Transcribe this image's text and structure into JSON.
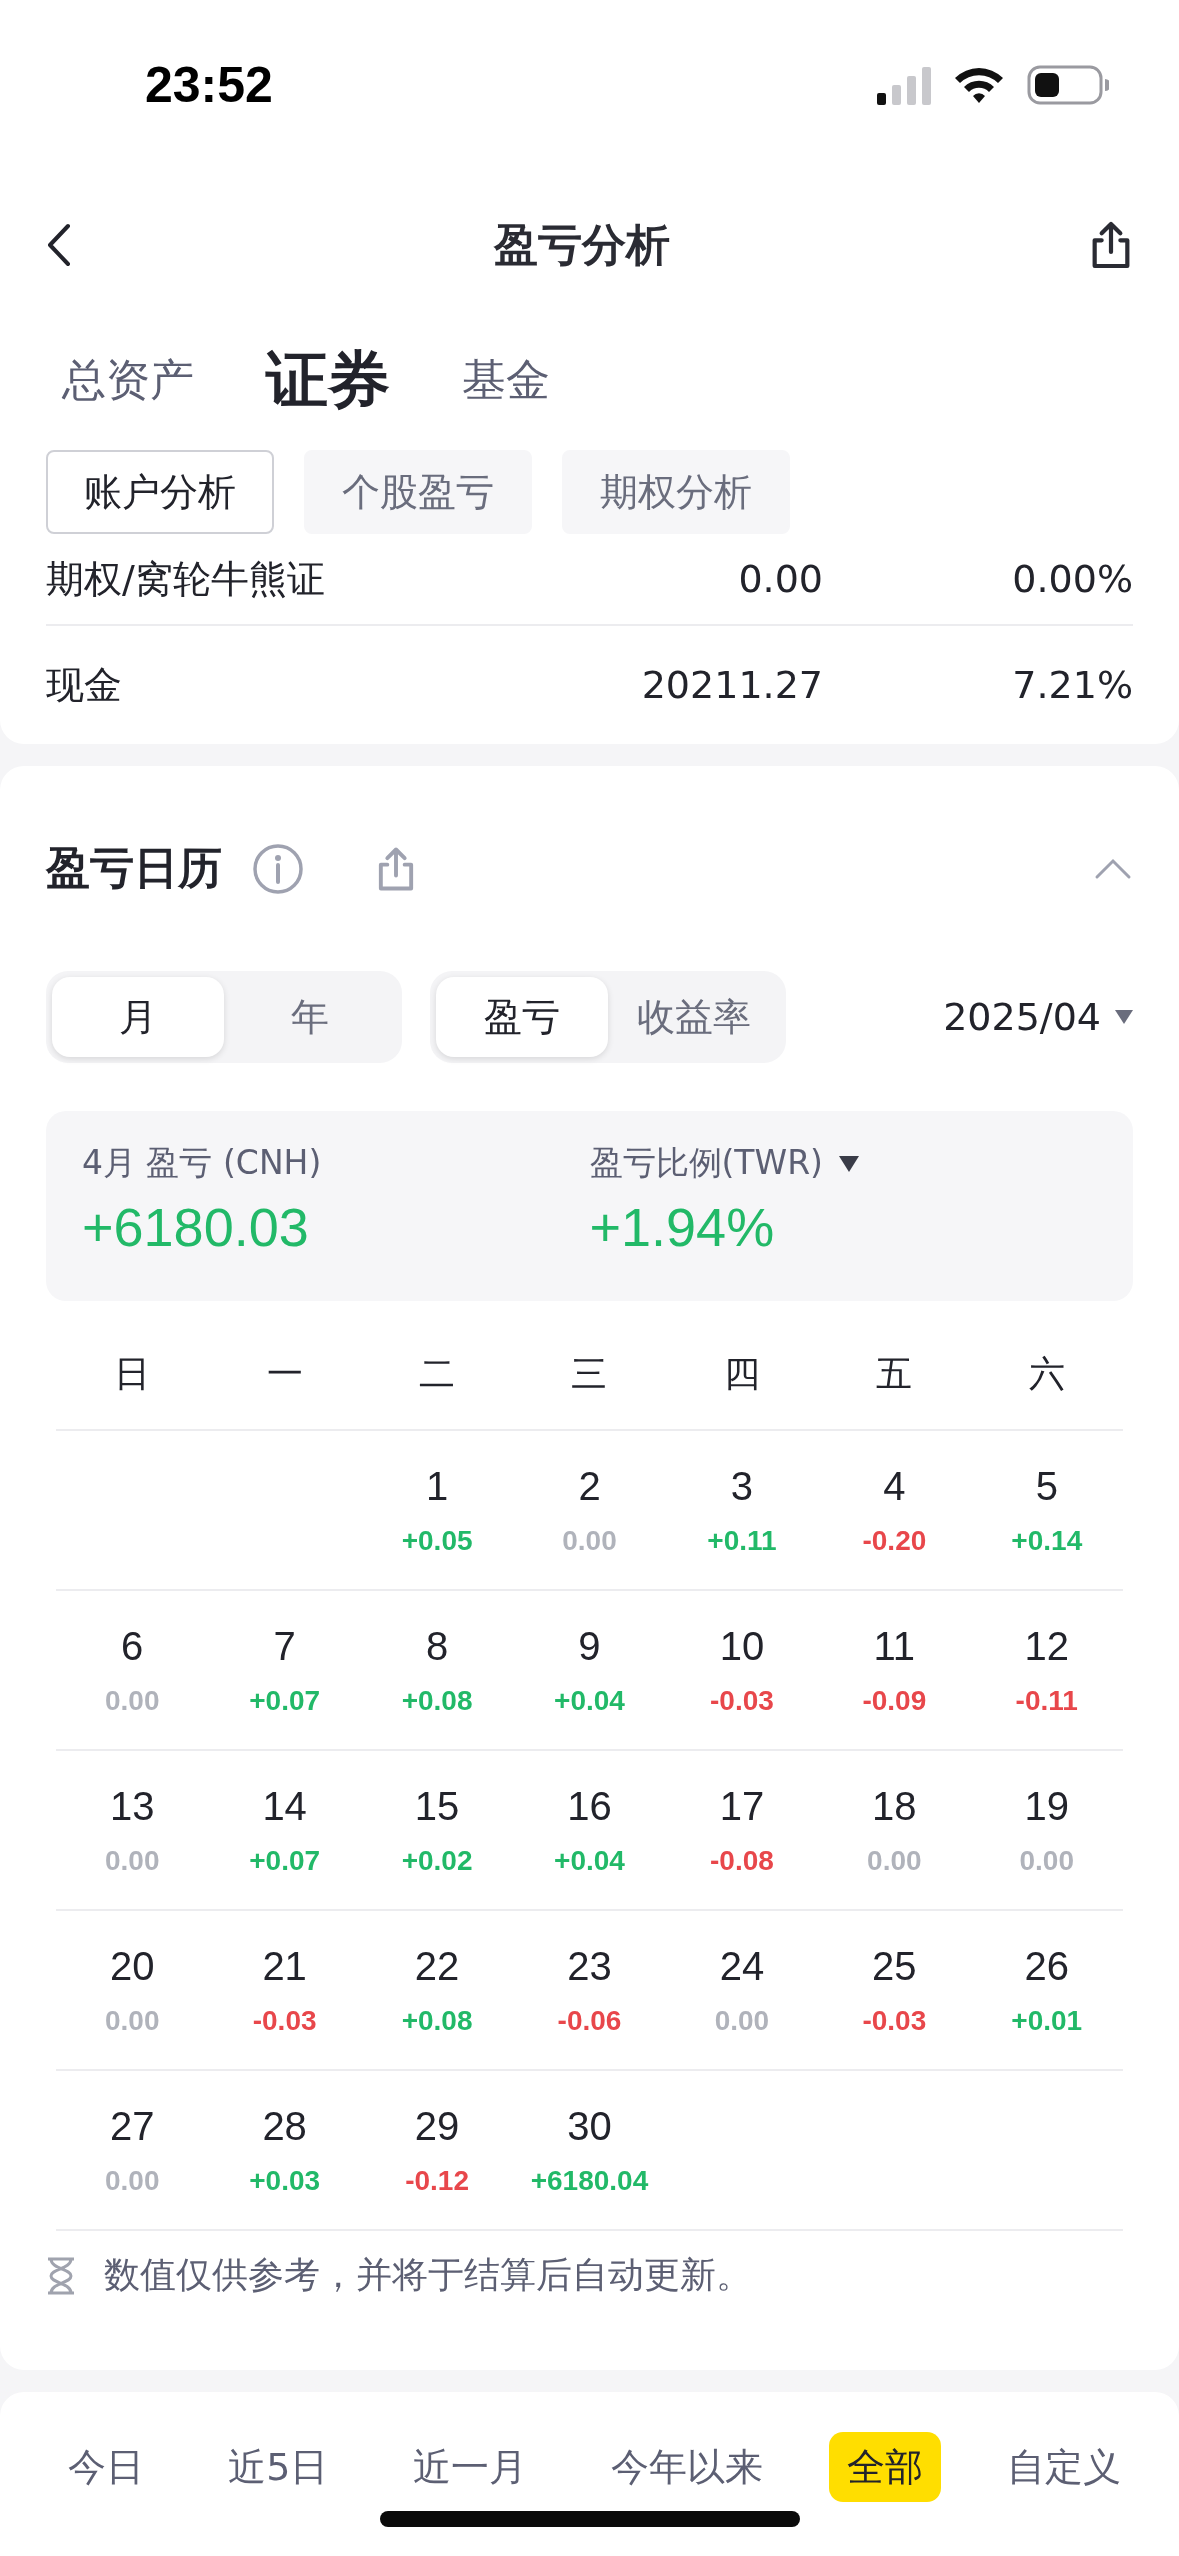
{
  "status_bar": {
    "time": "23:52"
  },
  "nav": {
    "title": "盈亏分析"
  },
  "asset_tabs": [
    {
      "label": "总资产",
      "selected": false
    },
    {
      "label": "证券",
      "selected": true
    },
    {
      "label": "基金",
      "selected": false
    }
  ],
  "sub_tabs": [
    {
      "label": "账户分析",
      "selected": true
    },
    {
      "label": "个股盈亏",
      "selected": false
    },
    {
      "label": "期权分析",
      "selected": false
    }
  ],
  "holdings": [
    {
      "name": "期权/窝轮牛熊证",
      "amount": "0.00",
      "ratio": "0.00%"
    },
    {
      "name": "现金",
      "amount": "20211.27",
      "ratio": "7.21%"
    }
  ],
  "calendar_section": {
    "title": "盈亏日历",
    "period_toggle": [
      {
        "label": "月",
        "selected": true
      },
      {
        "label": "年",
        "selected": false
      }
    ],
    "metric_toggle": [
      {
        "label": "盈亏",
        "selected": true
      },
      {
        "label": "收益率",
        "selected": false
      }
    ],
    "date_picker": "2025/04",
    "summary": {
      "pnl_label": "4月 盈亏 (CNH)",
      "pnl_value": "+6180.03",
      "ratio_label": "盈亏比例(TWR)",
      "ratio_value": "+1.94%"
    },
    "weekdays": [
      "日",
      "一",
      "二",
      "三",
      "四",
      "五",
      "六"
    ],
    "weeks": [
      {
        "kind": "first",
        "days": [
          {
            "day": "1",
            "value": "+0.05",
            "kind": "gain"
          },
          {
            "day": "2",
            "value": "0.00",
            "kind": "flat"
          },
          {
            "day": "3",
            "value": "+0.11",
            "kind": "gain"
          },
          {
            "day": "4",
            "value": "-0.20",
            "kind": "loss"
          },
          {
            "day": "5",
            "value": "+0.14",
            "kind": "gain"
          }
        ]
      },
      {
        "kind": "full",
        "days": [
          {
            "day": "6",
            "value": "0.00",
            "kind": "flat"
          },
          {
            "day": "7",
            "value": "+0.07",
            "kind": "gain"
          },
          {
            "day": "8",
            "value": "+0.08",
            "kind": "gain"
          },
          {
            "day": "9",
            "value": "+0.04",
            "kind": "gain"
          },
          {
            "day": "10",
            "value": "-0.03",
            "kind": "loss"
          },
          {
            "day": "11",
            "value": "-0.09",
            "kind": "loss"
          },
          {
            "day": "12",
            "value": "-0.11",
            "kind": "loss"
          }
        ]
      },
      {
        "kind": "full",
        "days": [
          {
            "day": "13",
            "value": "0.00",
            "kind": "flat"
          },
          {
            "day": "14",
            "value": "+0.07",
            "kind": "gain"
          },
          {
            "day": "15",
            "value": "+0.02",
            "kind": "gain"
          },
          {
            "day": "16",
            "value": "+0.04",
            "kind": "gain"
          },
          {
            "day": "17",
            "value": "-0.08",
            "kind": "loss"
          },
          {
            "day": "18",
            "value": "0.00",
            "kind": "flat"
          },
          {
            "day": "19",
            "value": "0.00",
            "kind": "flat"
          }
        ]
      },
      {
        "kind": "full",
        "days": [
          {
            "day": "20",
            "value": "0.00",
            "kind": "flat"
          },
          {
            "day": "21",
            "value": "-0.03",
            "kind": "loss"
          },
          {
            "day": "22",
            "value": "+0.08",
            "kind": "gain"
          },
          {
            "day": "23",
            "value": "-0.06",
            "kind": "loss"
          },
          {
            "day": "24",
            "value": "0.00",
            "kind": "flat"
          },
          {
            "day": "25",
            "value": "-0.03",
            "kind": "loss"
          },
          {
            "day": "26",
            "value": "+0.01",
            "kind": "gain"
          }
        ]
      },
      {
        "kind": "last",
        "days": [
          {
            "day": "27",
            "value": "0.00",
            "kind": "flat"
          },
          {
            "day": "28",
            "value": "+0.03",
            "kind": "gain"
          },
          {
            "day": "29",
            "value": "-0.12",
            "kind": "loss"
          },
          {
            "day": "30",
            "value": "+6180.04",
            "kind": "gain"
          }
        ]
      }
    ],
    "note": "数值仅供参考，并将于结算后自动更新。"
  },
  "range_tabs": [
    {
      "label": "今日",
      "selected": false
    },
    {
      "label": "近5日",
      "selected": false
    },
    {
      "label": "近一月",
      "selected": false
    },
    {
      "label": "今年以来",
      "selected": false
    },
    {
      "label": "全部",
      "selected": true
    },
    {
      "label": "自定义",
      "selected": false
    }
  ]
}
